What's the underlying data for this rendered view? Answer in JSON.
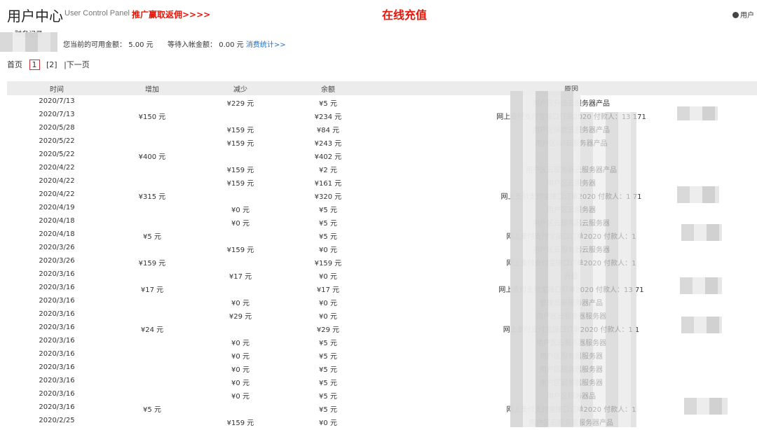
{
  "header": {
    "title": "用户中心",
    "subtitle": "User Control Panel",
    "promo": "推广赢取返佣>>>>",
    "recharge": "在线充值",
    "user_menu": "用户"
  },
  "tabs": {
    "finance": "财务记录"
  },
  "balance": {
    "available_label": "您当前的可用金额：",
    "available_value": "5.00 元",
    "pending_label": "等待入帐金额：",
    "pending_value": "0.00 元",
    "stats_link": "消费统计>>"
  },
  "pager": {
    "first": "首页",
    "page1": "1",
    "page2": "[2]",
    "next": "|下一页"
  },
  "table": {
    "headers": {
      "time": "时间",
      "increase": "增加",
      "decrease": "减少",
      "balance": "余额",
      "reason": "原因"
    },
    "rows": [
      {
        "time": "2020/7/13",
        "inc": "",
        "dec": "¥229 元",
        "bal": "¥5 元",
        "reason": "用户区升级云服务器产品"
      },
      {
        "time": "2020/7/13",
        "inc": "¥150 元",
        "dec": "",
        "bal": "¥234 元",
        "reason": "网上支付支付宝接口订单2020 付款人：13 171"
      },
      {
        "time": "2020/5/28",
        "inc": "",
        "dec": "¥159 元",
        "bal": "¥84 元",
        "reason": "用户区续费云服务器产品"
      },
      {
        "time": "2020/5/22",
        "inc": "",
        "dec": "¥159 元",
        "bal": "¥243 元",
        "reason": "用户区(s)云服务器产品"
      },
      {
        "time": "2020/5/22",
        "inc": "¥400 元",
        "dec": "",
        "bal": "¥402 元",
        "reason": ""
      },
      {
        "time": "2020/4/22",
        "inc": "",
        "dec": "¥159 元",
        "bal": "¥2 元",
        "reason": "用户区云服务器云服务器产品"
      },
      {
        "time": "2020/4/22",
        "inc": "",
        "dec": "¥159 元",
        "bal": "¥161 元",
        "reason": "用户区云服务器"
      },
      {
        "time": "2020/4/22",
        "inc": "¥315 元",
        "dec": "",
        "bal": "¥320 元",
        "reason": "网上支付支付宝接口订单2020 付款人：1 71"
      },
      {
        "time": "2020/4/19",
        "inc": "",
        "dec": "¥0 元",
        "bal": "¥5 元",
        "reason": "用户区云服务器"
      },
      {
        "time": "2020/4/18",
        "inc": "",
        "dec": "¥0 元",
        "bal": "¥5 元",
        "reason": "用户区云服务器云服务器"
      },
      {
        "time": "2020/4/18",
        "inc": "¥5 元",
        "dec": "",
        "bal": "¥5 元",
        "reason": "网上支付支付宝接口订单2020 付款人：1"
      },
      {
        "time": "2020/3/26",
        "inc": "",
        "dec": "¥159 元",
        "bal": "¥0 元",
        "reason": "用户区云服务器云服务器"
      },
      {
        "time": "2020/3/26",
        "inc": "¥159 元",
        "dec": "",
        "bal": "¥159 元",
        "reason": "网上支付支付宝接口订单2020 付款人：1"
      },
      {
        "time": "2020/3/16",
        "inc": "",
        "dec": "¥17 元",
        "bal": "¥0 元",
        "reason": "升级"
      },
      {
        "time": "2020/3/16",
        "inc": "¥17 元",
        "dec": "",
        "bal": "¥17 元",
        "reason": "网上支付支付宝接口订单2020 付款人：13 71"
      },
      {
        "time": "2020/3/16",
        "inc": "",
        "dec": "¥0 元",
        "bal": "¥0 元",
        "reason": "管理员新服务器产品"
      },
      {
        "time": "2020/3/16",
        "inc": "",
        "dec": "¥29 元",
        "bal": "¥0 元",
        "reason": "用户区云服务器服务器"
      },
      {
        "time": "2020/3/16",
        "inc": "¥24 元",
        "dec": "",
        "bal": "¥29 元",
        "reason": "网上支付支付宝接口订单2020 付款人：1 1"
      },
      {
        "time": "2020/3/16",
        "inc": "",
        "dec": "¥0 元",
        "bal": "¥5 元",
        "reason": "用户区云服务器服务器"
      },
      {
        "time": "2020/3/16",
        "inc": "",
        "dec": "¥0 元",
        "bal": "¥5 元",
        "reason": "用户区服务器服务器"
      },
      {
        "time": "2020/3/16",
        "inc": "",
        "dec": "¥0 元",
        "bal": "¥5 元",
        "reason": "用户区服务器服务器"
      },
      {
        "time": "2020/3/16",
        "inc": "",
        "dec": "¥0 元",
        "bal": "¥5 元",
        "reason": "用户区服务器服务器"
      },
      {
        "time": "2020/3/16",
        "inc": "",
        "dec": "¥0 元",
        "bal": "¥5 元",
        "reason": "用户区服务器品"
      },
      {
        "time": "2020/3/16",
        "inc": "¥5 元",
        "dec": "",
        "bal": "¥5 元",
        "reason": "网上支付支付宝接口订单2020 付款人：1"
      },
      {
        "time": "2020/2/25",
        "inc": "",
        "dec": "¥159 元",
        "bal": "¥0 元",
        "reason": "用户区云服务器服务器产品"
      }
    ]
  }
}
